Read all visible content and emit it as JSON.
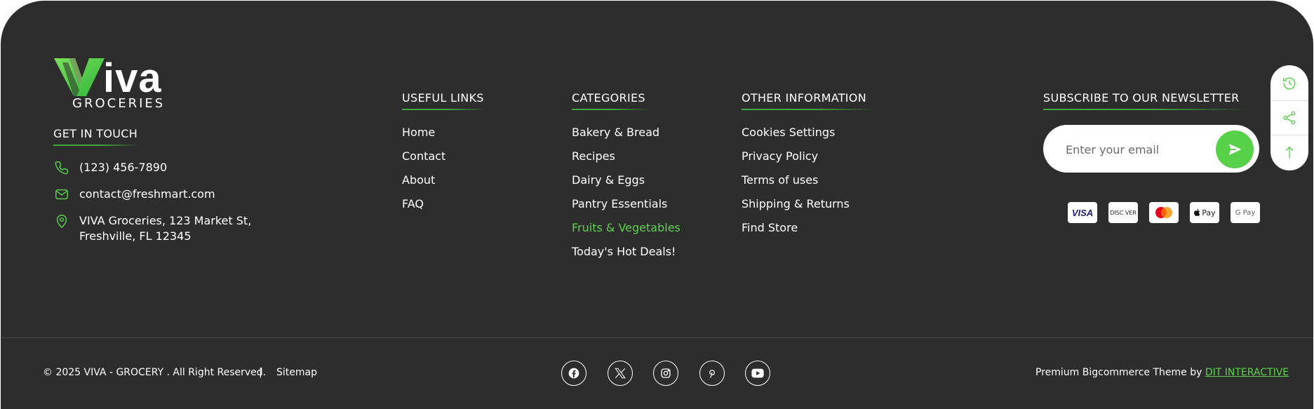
{
  "brand": {
    "logo_main": "iva",
    "logo_sub": "GROCERIES",
    "accent_color": "#57d04a",
    "background_color": "#2d2d2d"
  },
  "contact": {
    "heading": "GET IN TOUCH",
    "phone": "(123) 456-7890",
    "email": "contact@freshmart.com",
    "address_line1": "VIVA Groceries, 123 Market St,",
    "address_line2": "Freshville, FL 12345"
  },
  "useful_links": {
    "heading": "USEFUL LINKS",
    "items": [
      "Home",
      "Contact",
      "About",
      "FAQ"
    ]
  },
  "categories": {
    "heading": "CATEGORIES",
    "items": [
      "Bakery & Bread",
      "Recipes",
      "Dairy & Eggs",
      "Pantry Essentials",
      "Fruits & Vegetables",
      "Today's Hot Deals!"
    ],
    "active_item": "Fruits & Vegetables"
  },
  "other_info": {
    "heading": "OTHER INFORMATION",
    "items": [
      "Cookies Settings",
      "Privacy Policy",
      "Terms of uses",
      "Shipping & Returns",
      "Find Store"
    ]
  },
  "newsletter": {
    "heading": "SUBSCRIBE TO OUR NEWSLETTER",
    "placeholder": "Enter your email",
    "send_icon": "send-icon"
  },
  "payments": {
    "visa": "VISA",
    "discover": "DISC VER",
    "mastercard_icon": "mastercard-icon",
    "apple_pay": "Pay",
    "google_pay": "G Pay"
  },
  "side_toolbar": {
    "icons": [
      "history-icon",
      "share-icon",
      "arrow-up-icon"
    ]
  },
  "bottom": {
    "copyright": "© 2025 VIVA - GROCERY . All Right Reserved.",
    "separator": "|",
    "sitemap": "Sitemap",
    "social_icons": [
      "facebook-icon",
      "x-icon",
      "instagram-icon",
      "pinterest-icon",
      "youtube-icon"
    ],
    "credit_prefix": "Premium Bigcommerce Theme by",
    "credit_link": "DIT INTERACTIVE"
  }
}
